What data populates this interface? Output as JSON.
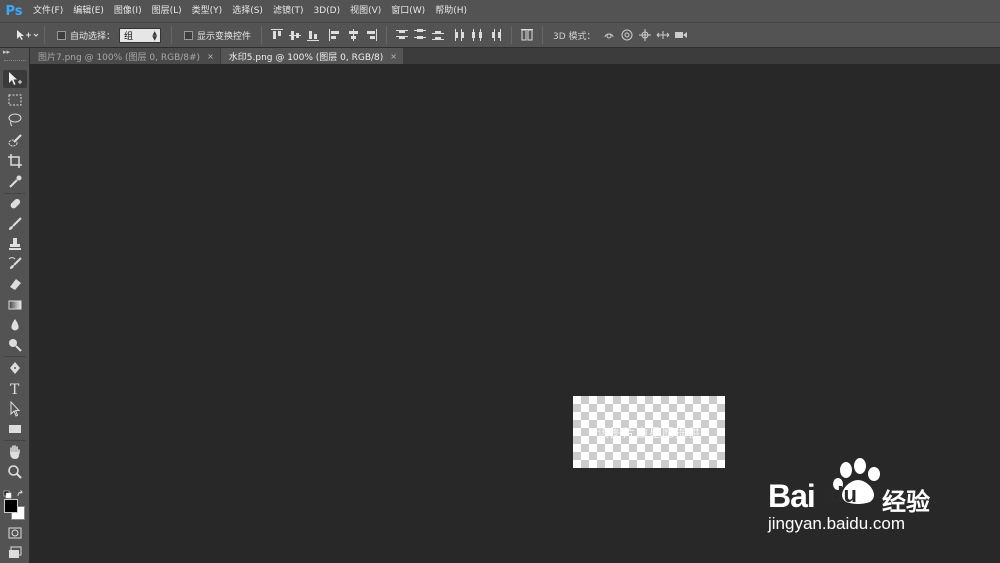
{
  "app": {
    "logo": "Ps"
  },
  "menu": [
    "文件(F)",
    "编辑(E)",
    "图像(I)",
    "图层(L)",
    "类型(Y)",
    "选择(S)",
    "滤镜(T)",
    "3D(D)",
    "视图(V)",
    "窗口(W)",
    "帮助(H)"
  ],
  "options": {
    "auto_select_label": "自动选择：",
    "group_value": "组",
    "show_transform_label": "显示变换控件",
    "mode3d_label": "3D 模式："
  },
  "tabs": [
    {
      "label": "图片7.png @ 100% (图层 0, RGB/8#)",
      "close": "×",
      "active": false
    },
    {
      "label": "水印5.png @ 100% (图层 0, RGB/8)",
      "close": "×",
      "active": true
    }
  ],
  "document": {
    "watermark_text": "该图片由星愿提供"
  },
  "baidu": {
    "brand": "Bai",
    "brand_suffix": "du",
    "jingyan": "经验",
    "url": "jingyan.baidu.com"
  },
  "colors": {
    "ps_blue": "#3aa8ff",
    "chrome": "#535353",
    "canvas": "#282828"
  }
}
